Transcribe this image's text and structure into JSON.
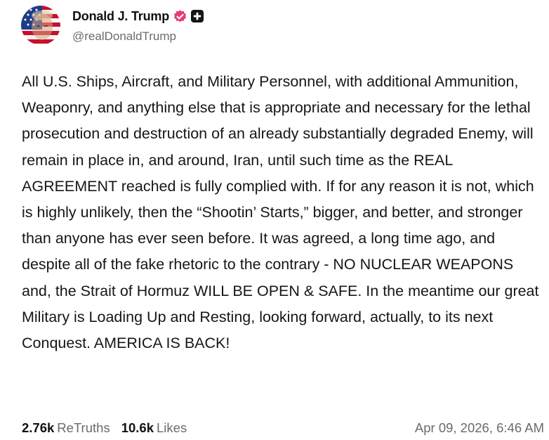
{
  "author": {
    "display_name": "Donald J. Trump",
    "handle": "@realDonaldTrump",
    "avatar_icon": "profile-photo-flag-overlay",
    "verified_icon": "verified-badge-icon",
    "verified_color": "#e93a6f",
    "badge_icon": "plus-badge-icon"
  },
  "post": {
    "text": "All U.S. Ships, Aircraft, and Military Personnel, with additional Ammunition, Weaponry, and anything else that is appropriate and necessary for the lethal prosecution and destruction of an already substantially degraded Enemy, will remain in place in, and around, Iran, until such time as the REAL AGREEMENT reached is fully complied with. If for any reason it is not, which is highly unlikely, then the “Shootin’ Starts,” bigger, and better, and stronger than anyone has ever seen before. It was agreed, a long time ago, and despite all of the fake rhetoric to the contrary - NO NUCLEAR WEAPONS and, the Strait of Hormuz WILL BE OPEN & SAFE. In the meantime our great Military is Loading Up and Resting, looking forward, actually, to its next Conquest. AMERICA IS BACK!"
  },
  "stats": {
    "retruths_count": "2.76k",
    "retruths_label": "ReTruths",
    "likes_count": "10.6k",
    "likes_label": "Likes",
    "timestamp": "Apr 09, 2026, 6:46 AM"
  }
}
